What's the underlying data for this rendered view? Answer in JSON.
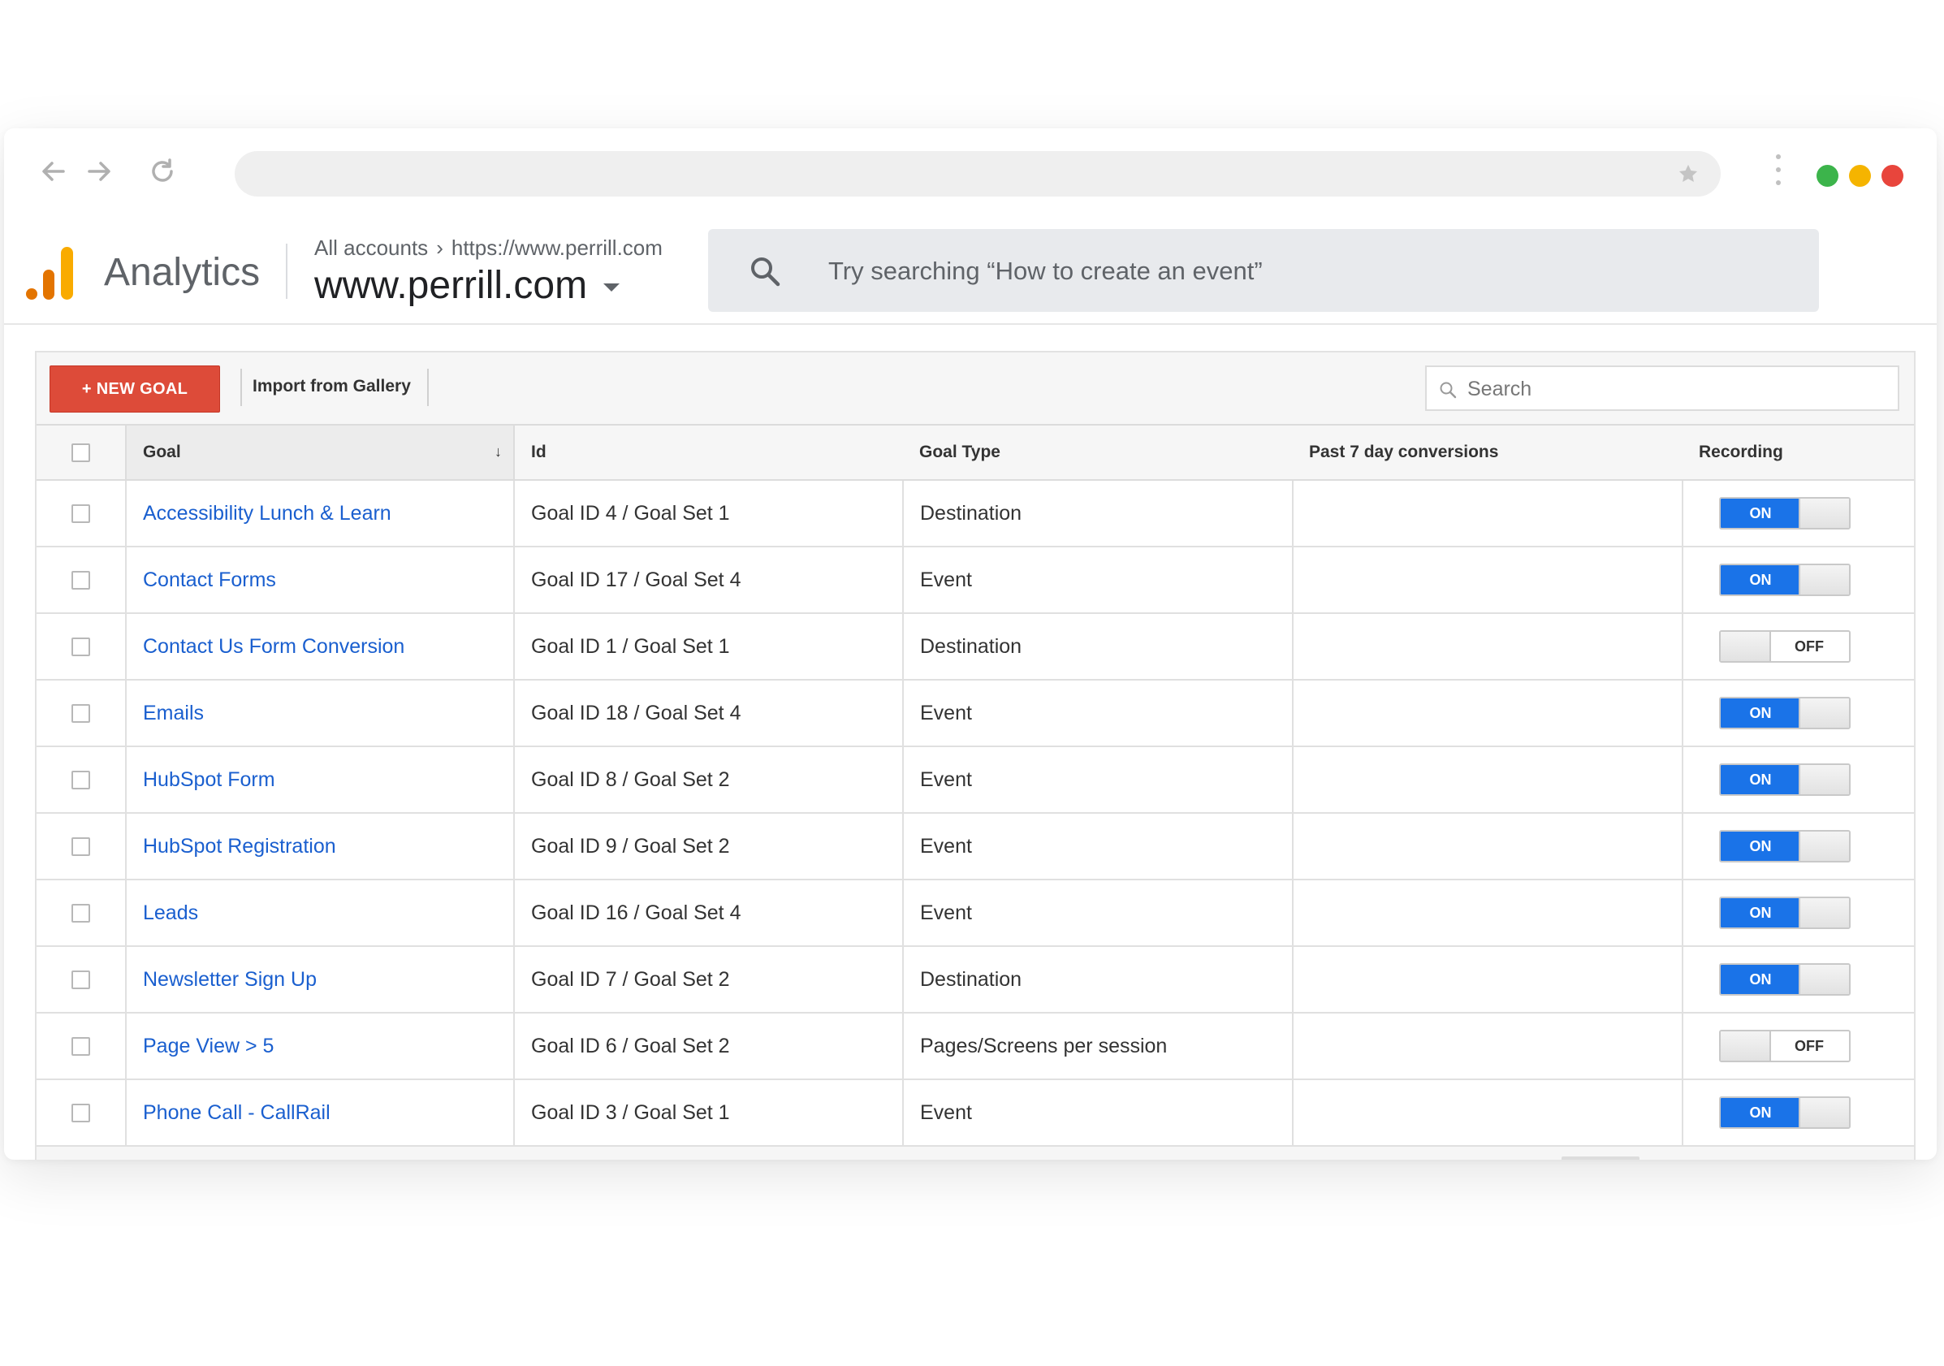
{
  "browser": {
    "colors": {
      "green": "#3cb44b",
      "yellow": "#f5b400",
      "red": "#e8453c"
    }
  },
  "header": {
    "app_name": "Analytics",
    "breadcrumb": {
      "account": "All accounts",
      "property_url": "https://www.perrill.com"
    },
    "property": "www.perrill.com",
    "search_placeholder": "Try searching “How to create an event”"
  },
  "toolbar": {
    "new_goal_label": "+ NEW GOAL",
    "import_label": "Import from Gallery",
    "search_placeholder": "Search"
  },
  "table": {
    "columns": {
      "goal": "Goal",
      "id": "Id",
      "goal_type": "Goal Type",
      "conversions": "Past 7 day conversions",
      "recording": "Recording"
    },
    "sort_icon": "sort-down-arrow",
    "rows": [
      {
        "goal": "Accessibility Lunch & Learn",
        "id": "Goal ID 4 / Goal Set 1",
        "type": "Destination",
        "conversions": "",
        "recording": "ON"
      },
      {
        "goal": "Contact Forms",
        "id": "Goal ID 17 / Goal Set 4",
        "type": "Event",
        "conversions": "",
        "recording": "ON"
      },
      {
        "goal": "Contact Us Form Conversion",
        "id": "Goal ID 1 / Goal Set 1",
        "type": "Destination",
        "conversions": "",
        "recording": "OFF"
      },
      {
        "goal": "Emails",
        "id": "Goal ID 18 / Goal Set 4",
        "type": "Event",
        "conversions": "",
        "recording": "ON"
      },
      {
        "goal": "HubSpot Form",
        "id": "Goal ID 8 / Goal Set 2",
        "type": "Event",
        "conversions": "",
        "recording": "ON"
      },
      {
        "goal": "HubSpot Registration",
        "id": "Goal ID 9 / Goal Set 2",
        "type": "Event",
        "conversions": "",
        "recording": "ON"
      },
      {
        "goal": "Leads",
        "id": "Goal ID 16 / Goal Set 4",
        "type": "Event",
        "conversions": "",
        "recording": "ON"
      },
      {
        "goal": "Newsletter Sign Up",
        "id": "Goal ID 7 / Goal Set 2",
        "type": "Destination",
        "conversions": "",
        "recording": "ON"
      },
      {
        "goal": "Page View > 5",
        "id": "Goal ID 6 / Goal Set 2",
        "type": "Pages/Screens per session",
        "conversions": "",
        "recording": "OFF"
      },
      {
        "goal": "Phone Call - CallRail",
        "id": "Goal ID 3 / Goal Set 1",
        "type": "Event",
        "conversions": "",
        "recording": "ON"
      }
    ]
  },
  "colors": {
    "link": "#1a5fcf",
    "toggle_on": "#1a73e8",
    "new_goal": "#dd4b39"
  }
}
